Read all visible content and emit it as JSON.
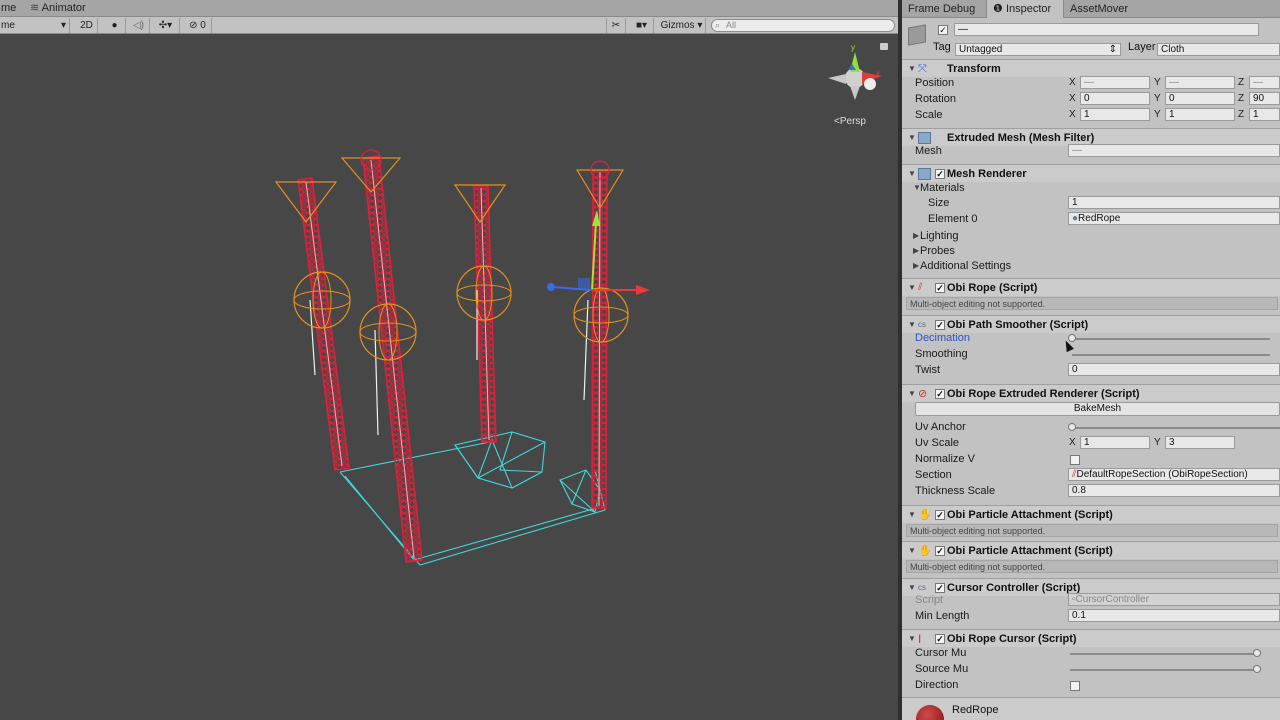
{
  "scene": {
    "tabs": [
      {
        "label": "me"
      },
      {
        "label": "Animator"
      }
    ],
    "toolbar": {
      "shading_dropdown": "me",
      "mode_2d": "2D",
      "effects_count": "0",
      "gizmos": "Gizmos",
      "search_placeholder": "All"
    },
    "persp_label": "Persp"
  },
  "inspector": {
    "tabs": [
      {
        "label": "Frame Debug"
      },
      {
        "label": "Inspector"
      },
      {
        "label": "AssetMover"
      }
    ],
    "object": {
      "name": "—",
      "tag_label": "Tag",
      "tag_value": "Untagged",
      "layer_label": "Layer",
      "layer_value": "Cloth"
    },
    "transform": {
      "title": "Transform",
      "position_label": "Position",
      "rotation_label": "Rotation",
      "scale_label": "Scale",
      "position": {
        "x": "—",
        "y": "—",
        "z": "—"
      },
      "rotation": {
        "x": "0",
        "y": "0",
        "z": "90"
      },
      "scale": {
        "x": "1",
        "y": "1",
        "z": "1"
      },
      "axis_x": "X",
      "axis_y": "Y",
      "axis_z": "Z"
    },
    "mesh_filter": {
      "title": "Extruded Mesh (Mesh Filter)",
      "mesh_label": "Mesh",
      "mesh_value": "—"
    },
    "mesh_renderer": {
      "title": "Mesh Renderer",
      "materials_label": "Materials",
      "size_label": "Size",
      "size_value": "1",
      "element0_label": "Element 0",
      "element0_value": "RedRope",
      "lighting_label": "Lighting",
      "probes_label": "Probes",
      "additional_label": "Additional Settings"
    },
    "obi_rope": {
      "title": "Obi Rope (Script)",
      "note": "Multi-object editing not supported."
    },
    "path_smoother": {
      "title": "Obi Path Smoother (Script)",
      "decimation_label": "Decimation",
      "smoothing_label": "Smoothing",
      "twist_label": "Twist",
      "twist_value": "0",
      "decimation_level": 0,
      "smoothing_level": 0
    },
    "extruded_renderer": {
      "title": "Obi Rope Extruded Renderer (Script)",
      "bake_button": "BakeMesh",
      "uv_anchor_label": "Uv Anchor",
      "uv_anchor_level": 0,
      "uv_scale_label": "Uv Scale",
      "uv_scale_x": "1",
      "uv_scale_y": "3",
      "normalize_label": "Normalize V",
      "normalize_checked": false,
      "section_label": "Section",
      "section_value": "DefaultRopeSection (ObiRopeSection)",
      "thickness_label": "Thickness Scale",
      "thickness_value": "0.8"
    },
    "attachment1": {
      "title": "Obi Particle Attachment (Script)",
      "note": "Multi-object editing not supported."
    },
    "attachment2": {
      "title": "Obi Particle Attachment (Script)",
      "note": "Multi-object editing not supported."
    },
    "cursor_controller": {
      "title": "Cursor Controller (Script)",
      "script_label": "Script",
      "script_value": "CursorController",
      "min_length_label": "Min Length",
      "min_length_value": "0.1"
    },
    "rope_cursor": {
      "title": "Obi Rope Cursor (Script)",
      "cursor_mu_label": "Cursor Mu",
      "source_mu_label": "Source Mu",
      "direction_label": "Direction",
      "cursor_mu_level": 1,
      "source_mu_level": 1,
      "direction_checked": false
    },
    "material_preview": {
      "name": "RedRope"
    }
  },
  "colors": {
    "rope": "#e0203a",
    "collider": "#e8901a",
    "mesh_bounds": "#3fd8d8",
    "selection_blue": "#2a56c6"
  }
}
